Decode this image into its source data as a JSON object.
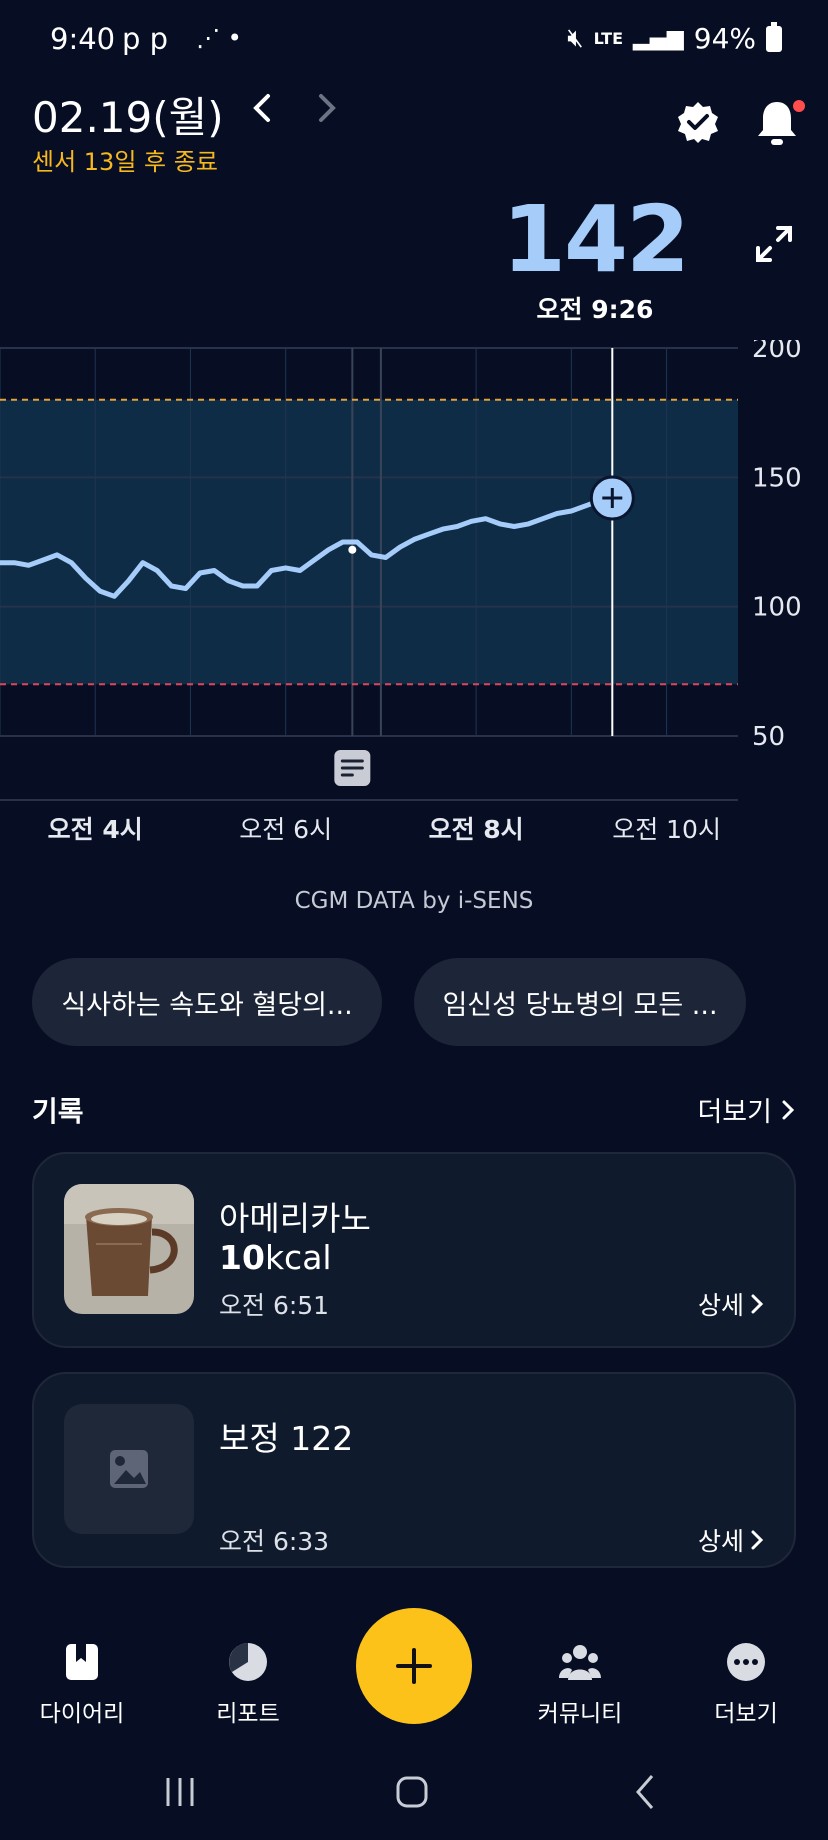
{
  "status_bar": {
    "time": "9:40",
    "indicators": "p p",
    "network": "LTE",
    "battery": "94%"
  },
  "header": {
    "date": "02.19(월)",
    "sensor_note": "센서 13일 후 종료",
    "prev_icon": "chevron-left-icon",
    "next_icon": "chevron-right-icon",
    "verified_icon": "verified-badge-icon",
    "bell_icon": "bell-icon"
  },
  "current": {
    "value": "142",
    "time": "오전 9:26",
    "expand_icon": "expand-icon"
  },
  "chart_data": {
    "type": "line",
    "y_ticks": [
      "200",
      "150",
      "100",
      "50"
    ],
    "ylim": [
      50,
      200
    ],
    "x_ticks": [
      "오전 4시",
      "오전 6시",
      "오전 8시",
      "오전 10시"
    ],
    "x_ticks_bold": [
      true,
      false,
      true,
      false
    ],
    "target_range": [
      70,
      180
    ],
    "series": [
      {
        "x_hours": [
          3.0,
          3.15,
          3.3,
          3.45,
          3.6,
          3.75,
          3.9,
          4.05,
          4.2,
          4.35,
          4.5,
          4.65,
          4.8,
          4.95,
          5.1,
          5.25,
          5.4,
          5.55,
          5.7,
          5.85,
          6.0,
          6.15,
          6.3,
          6.45,
          6.6,
          6.75,
          6.9,
          7.05,
          7.2,
          7.35,
          7.5,
          7.65,
          7.8,
          7.95,
          8.1,
          8.25,
          8.4,
          8.55,
          8.7,
          8.85,
          9.0,
          9.15,
          9.3,
          9.43
        ],
        "values": [
          117,
          117,
          116,
          118,
          120,
          117,
          111,
          106,
          104,
          110,
          117,
          114,
          108,
          107,
          113,
          114,
          110,
          108,
          108,
          114,
          115,
          114,
          118,
          122,
          125,
          125,
          120,
          119,
          123,
          126,
          128,
          130,
          131,
          133,
          134,
          132,
          131,
          132,
          134,
          136,
          137,
          139,
          141,
          142
        ]
      }
    ],
    "current_marker": {
      "x_hour": 9.43,
      "value": 142,
      "icon": "plus-icon"
    },
    "note_marker_icon": "note-icon"
  },
  "cgm_credit": "CGM DATA by i-SENS",
  "chips": [
    "식사하는 속도와 혈당의...",
    "임신성 당뇨병의 모든 ..."
  ],
  "records": {
    "title": "기록",
    "more": "더보기",
    "items": [
      {
        "title": "아메리카노",
        "kcal_value": "10",
        "kcal_unit": "kcal",
        "time": "오전 6:51",
        "detail": "상세"
      },
      {
        "title": "보정 122",
        "time": "오전 6:33",
        "detail": "상세",
        "thumb_icon": "image-placeholder-icon"
      }
    ]
  },
  "nav": {
    "items": [
      {
        "label": "다이어리",
        "icon": "diary-icon"
      },
      {
        "label": "리포트",
        "icon": "report-icon"
      },
      {
        "label": "커뮤니티",
        "icon": "community-icon"
      },
      {
        "label": "더보기",
        "icon": "more-icon"
      }
    ],
    "fab_icon": "plus-icon"
  },
  "colors": {
    "background": "#070e24",
    "accent_yellow": "#fcc21a",
    "glucose_blue": "#a6cdfa",
    "range_fill": "#0f2c47",
    "high_line": "#e3a23a",
    "low_line": "#e0445a"
  }
}
